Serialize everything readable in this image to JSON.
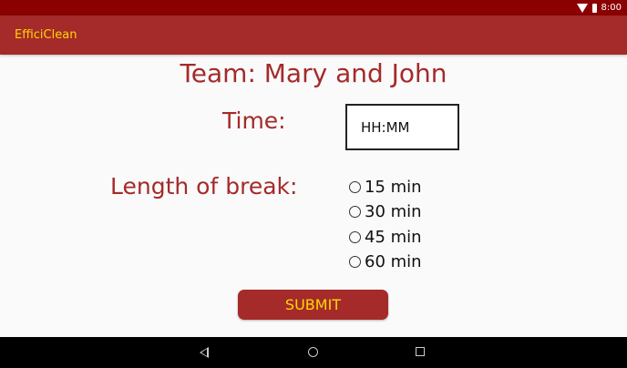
{
  "status_bar": {
    "time": "8:00",
    "icons": [
      "wifi-icon",
      "battery-icon"
    ],
    "color": "#8b0000"
  },
  "app_bar": {
    "title": "EfficiClean",
    "color": "#a52a2a",
    "title_color": "#ffd700"
  },
  "form": {
    "team_title": "Team: Mary and John",
    "time_label": "Time:",
    "time_placeholder": "HH:MM",
    "break_label": "Length of break:",
    "break_options": [
      {
        "label": "15 min",
        "selected": false
      },
      {
        "label": "30 min",
        "selected": false
      },
      {
        "label": "45 min",
        "selected": false
      },
      {
        "label": "60 min",
        "selected": false
      }
    ],
    "submit_label": "SUBMIT"
  },
  "nav_bar": {
    "buttons": [
      "back-icon",
      "home-icon",
      "recents-icon"
    ]
  }
}
